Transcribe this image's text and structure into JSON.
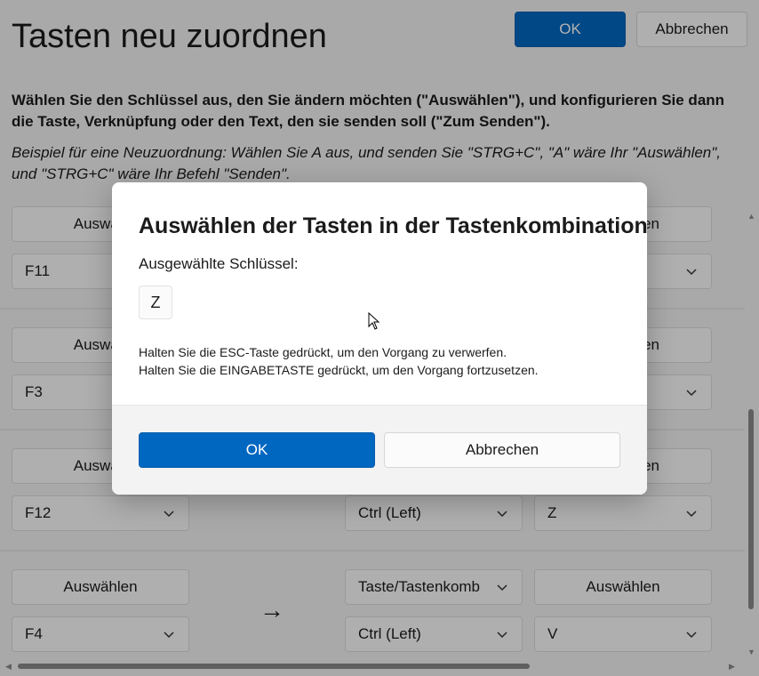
{
  "header": {
    "title": "Tasten neu zuordnen",
    "ok_label": "OK",
    "cancel_label": "Abbrechen"
  },
  "description": {
    "bold": "Wählen Sie den Schlüssel aus, den Sie ändern möchten (\"Auswählen\"), und konfigurieren Sie dann die Taste, Verknüpfung oder den Text, den sie senden soll (\"Zum Senden\").",
    "example": "Beispiel für eine Neuzuordnung: Wählen Sie A aus, und senden Sie \"STRG+C\", \"A\" wäre Ihr \"Auswählen\", und \"STRG+C\" wäre Ihr Befehl \"Senden\"."
  },
  "rows": [
    {
      "select_label": "Auswählen",
      "source_key": "F11",
      "target_type": "",
      "target_key": "",
      "send_label": "en"
    },
    {
      "select_label": "Auswählen",
      "source_key": "F3",
      "target_type": "",
      "target_key": "",
      "send_label": "en"
    },
    {
      "select_label": "Auswählen",
      "source_key": "F12",
      "target_type": "",
      "target_key": "Ctrl (Left)",
      "target_key2": "Z",
      "send_label": "en"
    },
    {
      "select_label": "Auswählen",
      "source_key": "F4",
      "target_type": "Taste/Tastenkomb",
      "target_key": "Ctrl (Left)",
      "target_key2": "V",
      "send_label": "Auswählen"
    }
  ],
  "partial_labels": {
    "row1_select": "Auswäh",
    "row2_select": "Auswäh",
    "row3_select": "Auswäh",
    "row1_send": "en",
    "row2_send": "en",
    "row3_send": "en"
  },
  "arrow_glyph": "→",
  "dialog": {
    "title": "Auswählen der Tasten in der Tastenkombination",
    "subtitle": "Ausgewählte Schlüssel:",
    "selected_key": "Z",
    "hint_esc": "Halten Sie die ESC-Taste gedrückt, um den Vorgang zu verwerfen.",
    "hint_enter": "Halten Sie die EINGABETASTE gedrückt, um den Vorgang fortzusetzen.",
    "ok_label": "OK",
    "cancel_label": "Abbrechen"
  },
  "colors": {
    "accent": "#0067c0",
    "overlay": "rgba(0,0,0,0.30)"
  }
}
